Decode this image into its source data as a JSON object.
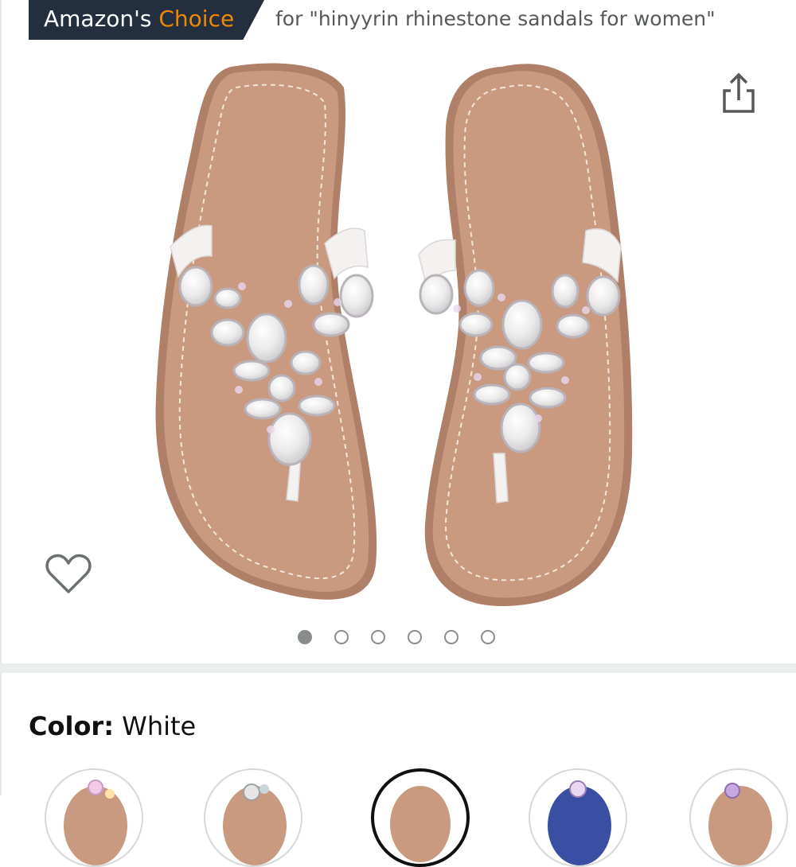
{
  "badge": {
    "prefix": "Amazon's",
    "highlight": "Choice"
  },
  "search_context": "for \"hinyyrin rhinestone sandals for women\"",
  "icons": {
    "share": "share-icon",
    "wishlist": "heart-icon"
  },
  "carousel": {
    "total": 6,
    "active_index": 0
  },
  "color": {
    "label": "Color:",
    "value": "White"
  },
  "swatches": [
    {
      "name": "swatch-1",
      "selected": false
    },
    {
      "name": "swatch-2",
      "selected": false
    },
    {
      "name": "swatch-white",
      "selected": true
    },
    {
      "name": "swatch-4",
      "selected": false
    },
    {
      "name": "swatch-5",
      "selected": false
    }
  ],
  "colors": {
    "badge_bg": "#232f3e",
    "badge_highlight": "#f08804",
    "footbed": "#c99a80",
    "strap": "#f4f1f1"
  }
}
